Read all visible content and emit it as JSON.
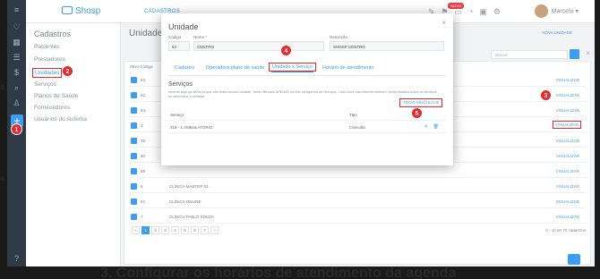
{
  "app": {
    "logo": "Shosp",
    "breadcrumb": "CADASTROS",
    "user_name": "Marcelo",
    "notif_badge": "NOVO"
  },
  "sidebar": {
    "title": "Cadastros",
    "items": [
      "Pacientes",
      "Prestadores",
      "Unidades",
      "Serviços",
      "Planos de Saúde",
      "Fornecedores",
      "Usuários do sistema"
    ]
  },
  "page": {
    "title": "Unidade",
    "new_button": "NOVA UNIDADE",
    "search_placeholder": "Buscar",
    "column_ativo": "Ativo",
    "column_codigo": "Código"
  },
  "table": {
    "rows": [
      {
        "id": "63",
        "name": ""
      },
      {
        "id": "62",
        "name": ""
      },
      {
        "id": "64",
        "name": ""
      },
      {
        "id": "3",
        "name": ""
      },
      {
        "id": "45",
        "name": ""
      },
      {
        "id": "60",
        "name": ""
      },
      {
        "id": "59",
        "name": ""
      },
      {
        "id": "6",
        "name": "CLÍNICA MASTER 01"
      },
      {
        "id": "57",
        "name": "CLÍNICA ONLINE"
      },
      {
        "id": "7",
        "name": "CLÍNICA PABLO SOUZA"
      }
    ],
    "action_label": "VISUALIZAR"
  },
  "pagination": {
    "pages": [
      "«",
      "1",
      "2",
      "3",
      "4",
      "5",
      "6",
      "7",
      "»"
    ],
    "info": "0 - 10 de 70 cadastros"
  },
  "modal": {
    "title": "Unidade",
    "fields": {
      "codigo_label": "Código",
      "codigo_value": "62",
      "nome_label": "Nome *",
      "nome_value": "CENTRO",
      "descricao_label": "Descrição",
      "descricao_value": "SHOSP CENTRO"
    },
    "tabs": [
      "Cadastro",
      "Operadora plano de saúde",
      "Unidade x Serviço",
      "Horário de atendimento"
    ],
    "services_title": "Serviços",
    "help_text": "Informe aqui os serviços que são feitos nessa Unidade. Serão filtrados APENAS na tela da Agenda de Serviços. Caso você não informe nenhum, serão listados todos os serviços ao selecionar a unidade.",
    "new_service": "NOVO VÍNCULO",
    "col_servico": "Serviço",
    "col_tipo": "Tipo",
    "service_row": {
      "servico": "218 - 1 AMBULATÓRIO",
      "tipo": "Consulta"
    }
  },
  "steps": [
    "1",
    "2",
    "3",
    "4",
    "5"
  ],
  "caption": "3. Configurar os horários de atendimento da agenda",
  "edge_marks": [
    "a",
    "a"
  ]
}
